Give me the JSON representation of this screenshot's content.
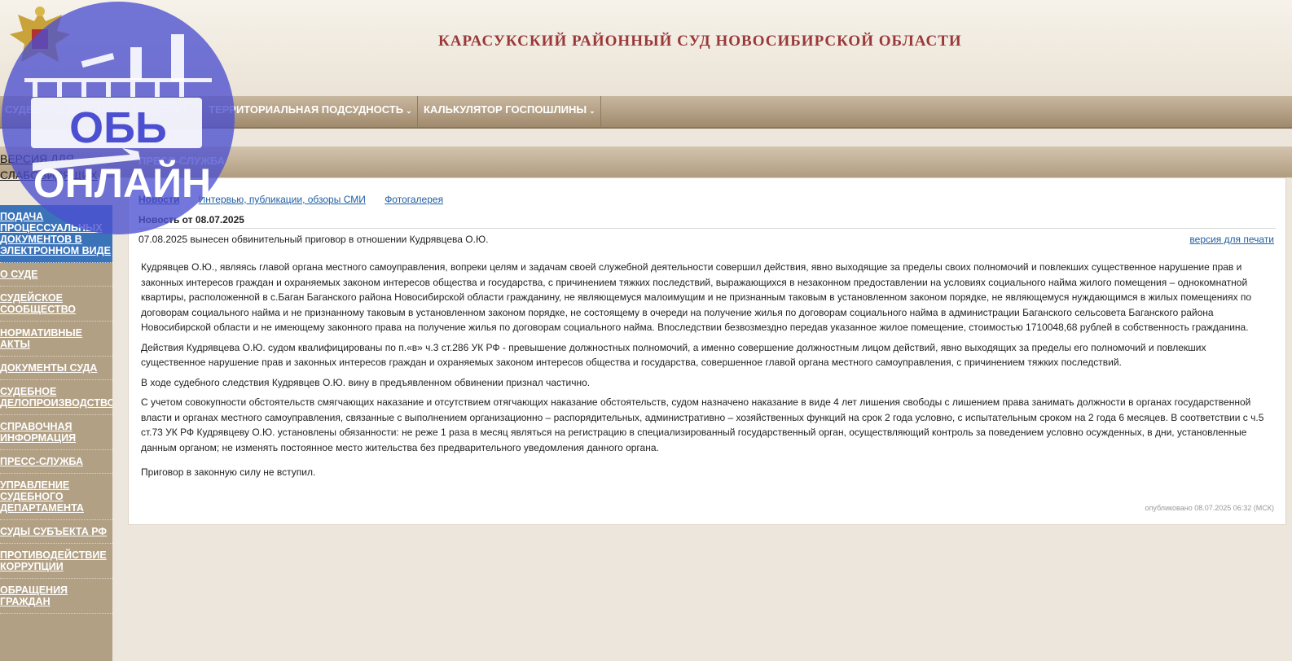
{
  "site_title": "КАРАСУКСКИЙ РАЙОННЫЙ СУД НОВОСИБИРСКОЙ ОБЛАСТИ",
  "topnav": [
    {
      "label": "СУДЕБНОЕ ДЕЛОПРОИЗВОДСТВО"
    },
    {
      "label": "ТЕРРИТОРИАЛЬНАЯ ПОДСУДНОСТЬ"
    },
    {
      "label": "КАЛЬКУЛЯТОР ГОСПОШЛИНЫ"
    }
  ],
  "section_title": "ПРЕСС-СЛУЖБА",
  "version_blind": "ВЕРСИЯ ДЛЯ СЛАБОВИДЯЩИХ",
  "sidebar": [
    {
      "label": "ПОДАЧА ПРОЦЕССУАЛЬНЫХ ДОКУМЕНТОВ В ЭЛЕКТРОННОМ ВИДЕ",
      "active": true
    },
    {
      "label": "О СУДЕ"
    },
    {
      "label": "СУДЕЙСКОЕ СООБЩЕСТВО"
    },
    {
      "label": "НОРМАТИВНЫЕ АКТЫ"
    },
    {
      "label": "ДОКУМЕНТЫ СУДА"
    },
    {
      "label": "СУДЕБНОЕ ДЕЛОПРОИЗВОДСТВО"
    },
    {
      "label": "СПРАВОЧНАЯ ИНФОРМАЦИЯ"
    },
    {
      "label": "ПРЕСС-СЛУЖБА"
    },
    {
      "label": "УПРАВЛЕНИЕ СУДЕБНОГО ДЕПАРТАМЕНТА"
    },
    {
      "label": "СУДЫ СУБЪЕКТА РФ"
    },
    {
      "label": "ПРОТИВОДЕЙСТВИЕ КОРРУПЦИИ"
    },
    {
      "label": "ОБРАЩЕНИЯ ГРАЖДАН"
    }
  ],
  "tabs": [
    {
      "label": "Новости",
      "current": true
    },
    {
      "label": "Интервью, публикации, обзоры СМИ"
    },
    {
      "label": "Фотогалерея"
    }
  ],
  "news_date_heading": "Новость от 08.07.2025",
  "news_title": "07.08.2025 вынесен обвинительный приговор в отношении Кудрявцева О.Ю.",
  "print_link": "версия для печати",
  "paragraphs": [
    "Кудрявцев О.Ю., являясь главой органа местного самоуправления, вопреки целям и задачам своей служебной деятельности совершил действия, явно выходящие за пределы своих полномочий и повлекших существенное нарушение прав и законных интересов граждан и охраняемых законом интересов общества и государства, с причинением тяжких последствий, выражающихся в незаконном предоставлении на условиях социального найма жилого помещения – однокомнатной квартиры, расположенной в с.Баган Баганского района Новосибирской области гражданину, не являющемуся малоимущим и не признанным таковым в установленном законом порядке, не являющемуся нуждающимся в жилых помещениях по договорам социального найма и не признанному таковым в установленном законом порядке, не состоящему в очереди на получение жилья по договорам социального найма в администрации Баганского сельсовета Баганского района Новосибирской области и не имеющему законного права на получение жилья по договорам социального найма. Впоследствии безвозмездно передав указанное жилое помещение, стоимостью 1710048,68 рублей в собственность гражданина.",
    "Действия Кудрявцева О.Ю. судом квалифицированы по п.«в» ч.3 ст.286 УК РФ - превышение должностных полномочий, а именно совершение должностным лицом действий, явно выходящих за пределы его полномочий и повлекших существенное нарушение прав и законных интересов граждан и охраняемых законом интересов общества и государства, совершенное главой органа местного самоуправления, с причинением тяжких последствий.",
    "В ходе судебного следствия Кудрявцев О.Ю. вину в предъявленном обвинении признал частично.",
    "С учетом совокупности обстоятельств смягчающих наказание и отсутствием отягчающих наказание обстоятельств, судом назначено наказание в виде 4 лет лишения свободы с лишением права занимать должности в органах государственной власти и органах местного самоуправления, связанные с выполнением организационно – распорядительных, административно – хозяйственных функций на срок 2 года условно, с испытательным сроком на 2 года 6 месяцев. В соответствии с ч.5 ст.73 УК РФ Кудрявцеву О.Ю. установлены обязанности: не реже 1 раза в месяц являться на регистрацию в специализированный государственный орган, осуществляющий контроль за поведением условно осужденных, в дни, установленные данным органом; не изменять постоянное место жительства без предварительного уведомления данного органа.",
    "Приговор в законную силу не вступил."
  ],
  "published": "опубликовано 08.07.2025 06:32 (МСК)",
  "watermark": {
    "line1": "ОБЬ",
    "line2": "ОНЛАЙН",
    "color": "#4b4fd0"
  },
  "colors": {
    "title": "#9a3838",
    "active_sidebar": "#3b73b9",
    "sidebar_bg": "#b2a084"
  }
}
